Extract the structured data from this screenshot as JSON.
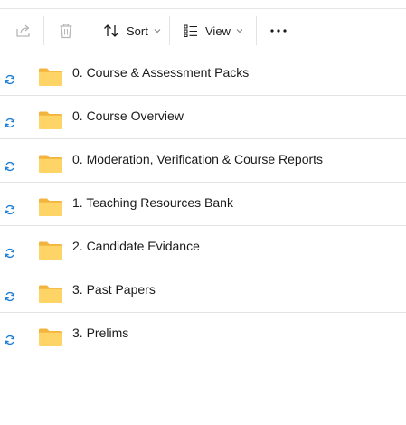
{
  "toolbar": {
    "share_icon": "share-icon",
    "delete_icon": "trash-icon",
    "sort_label": "Sort",
    "view_label": "View",
    "more_icon": "more-icon"
  },
  "colors": {
    "sync_blue": "#1f7fd4",
    "folder_yellow": "#ffd466",
    "folder_back": "#f2b43c",
    "disabled_gray": "#b7b7b7"
  },
  "files": [
    {
      "name": "0. Course & Assessment Packs",
      "status_icon": "sync-icon",
      "type_icon": "folder-icon"
    },
    {
      "name": "0. Course Overview",
      "status_icon": "sync-icon",
      "type_icon": "folder-icon"
    },
    {
      "name": "0. Moderation, Verification & Course Reports",
      "status_icon": "sync-icon",
      "type_icon": "folder-icon"
    },
    {
      "name": "1. Teaching Resources Bank",
      "status_icon": "sync-icon",
      "type_icon": "folder-icon"
    },
    {
      "name": "2. Candidate Evidance",
      "status_icon": "sync-icon",
      "type_icon": "folder-icon"
    },
    {
      "name": "3. Past Papers",
      "status_icon": "sync-icon",
      "type_icon": "folder-icon"
    },
    {
      "name": "3. Prelims",
      "status_icon": "sync-icon",
      "type_icon": "folder-icon"
    }
  ]
}
